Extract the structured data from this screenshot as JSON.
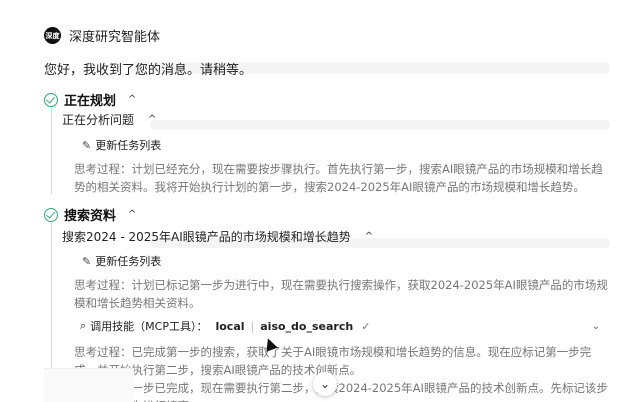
{
  "agent": {
    "avatar_text": "深度",
    "name": "深度研究智能体"
  },
  "greeting": "您好，我收到了您的消息。请稍等。",
  "planning": {
    "title": "正在规划",
    "subtitle": "正在分析问题",
    "task_update": "更新任务列表",
    "thought": "思考过程：计划已经充分，现在需要按步骤执行。首先执行第一步，搜索AI眼镜产品的市场规模和增长趋势的相关资料。我将开始执行计划的第一步，搜索2024-2025年AI眼镜产品的市场规模和增长趋势。"
  },
  "search": {
    "title": "搜索资料",
    "query": "搜索2024 - 2025年AI眼镜产品的市场规模和增长趋势",
    "task_update": "更新任务列表",
    "thought1": "思考过程：计划已标记第一步为进行中，现在需要执行搜索操作，获取2024-2025年AI眼镜产品的市场规模和增长趋势相关资料。",
    "tool_label": "调用技能（MCP工具）：",
    "tool_source": "local",
    "tool_name": "aiso_do_search",
    "thought2": "思考过程：已完成第一步的搜索，获取了关于AI眼镜市场规模和增长趋势的信息。现在应标记第一步完成，并开始执行第二步，搜索AI眼镜产品的技术创新点。",
    "thought3": "第一步已完成，现在需要执行第二步，搜索2024-2025年AI眼镜产品的技术创新点。先标记该步骤为进行搜索"
  },
  "colors": {
    "check": "#3aa676",
    "muted": "#777777"
  }
}
